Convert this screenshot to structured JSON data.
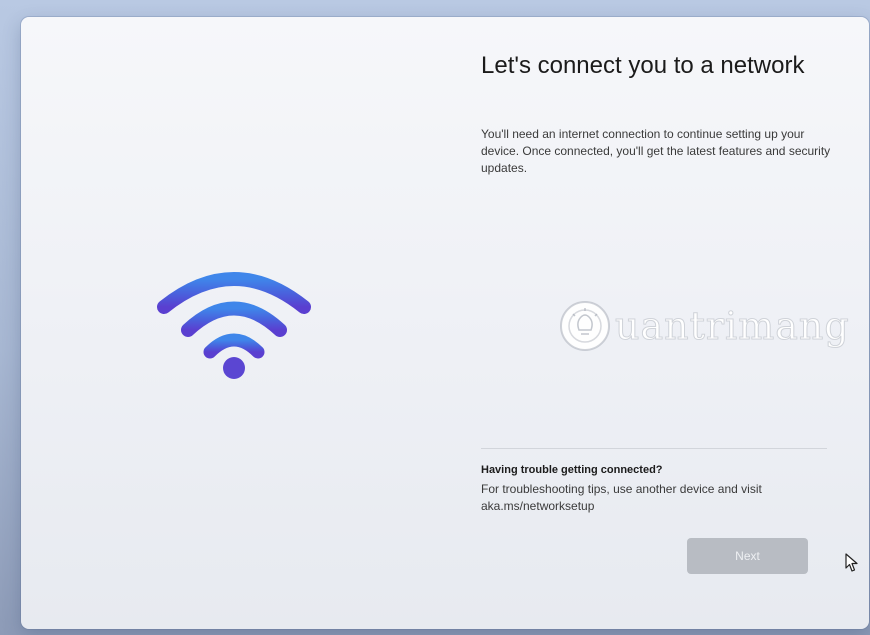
{
  "page": {
    "title": "Let's connect you to a network",
    "description": "You'll need an internet connection to continue setting up your device. Once connected, you'll get the latest features and security updates."
  },
  "illustration": {
    "icon": "wifi-icon",
    "colors": [
      "#3f7fe6",
      "#4f56d6",
      "#5a3fd0"
    ]
  },
  "help": {
    "title": "Having trouble getting connected?",
    "text": "For troubleshooting tips, use another device and visit aka.ms/networksetup"
  },
  "watermark": {
    "text": "uantrimang"
  },
  "actions": {
    "next_label": "Next",
    "next_enabled": false
  },
  "colors": {
    "accent_blue": "#2f6fe0",
    "button_disabled": "#b8bcc3"
  }
}
